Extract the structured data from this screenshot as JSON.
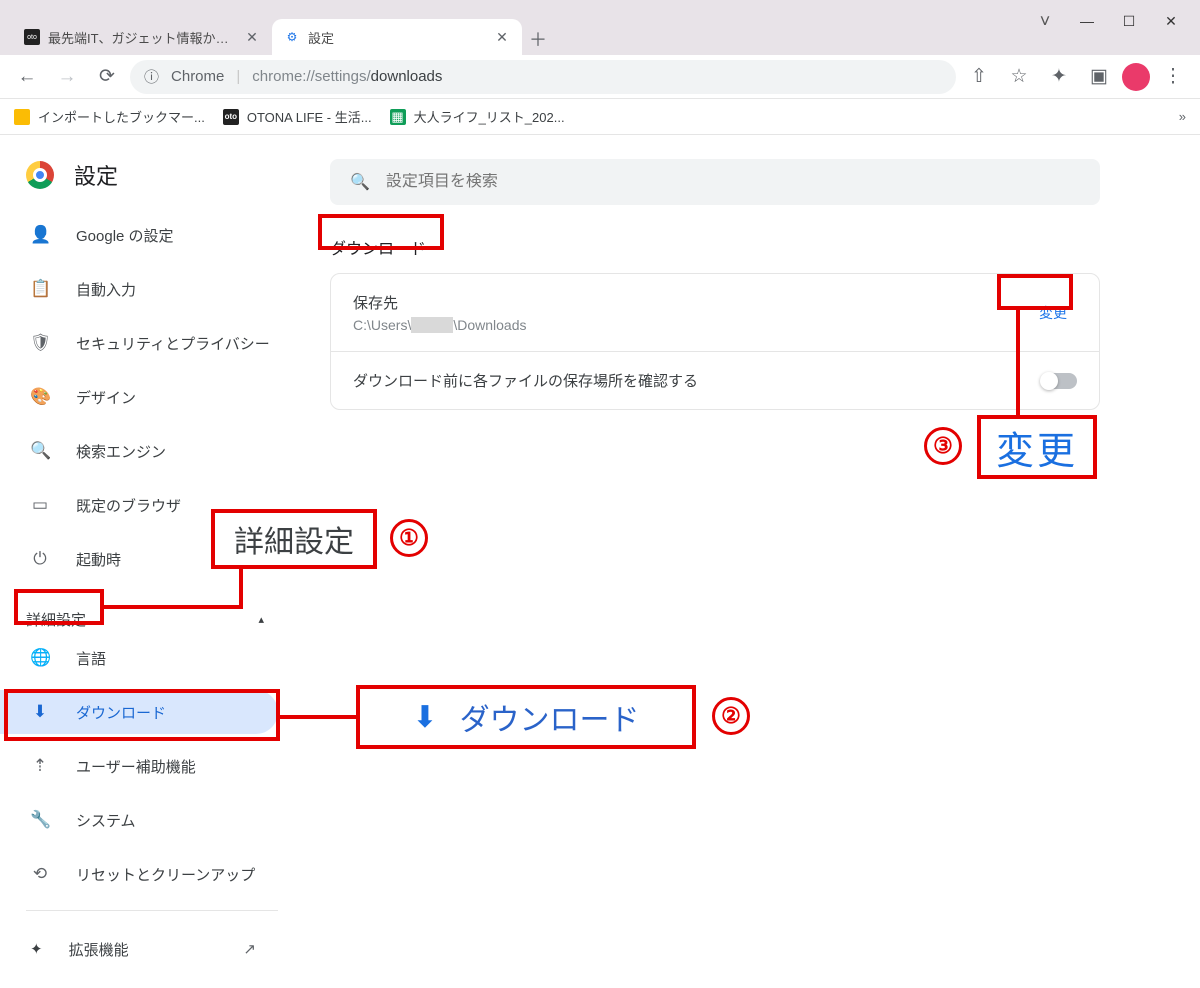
{
  "tabs": [
    {
      "title": "最先端IT、ガジェット情報からアナログ",
      "favicon": "oto"
    },
    {
      "title": "設定",
      "favicon": "gear"
    }
  ],
  "newtab": "＋",
  "winctl": {
    "chev": "˅",
    "min": "—",
    "max": "☐",
    "close": "✕"
  },
  "toolbar": {
    "back": "←",
    "fwd": "→",
    "reload": "⟳",
    "secure_label": "Chrome",
    "url_prefix": "chrome://settings/",
    "url_page": "downloads",
    "share": "⇧",
    "star": "☆",
    "ext": "✦",
    "panel": "▣",
    "menu": "⋮"
  },
  "bookmarks": [
    {
      "icon": "y",
      "label": "インポートしたブックマー..."
    },
    {
      "icon": "d",
      "label": "OTONA LIFE - 生活..."
    },
    {
      "icon": "g",
      "label": "大人ライフ_リスト_202..."
    }
  ],
  "bookmore": "»",
  "sidebar": {
    "title": "設定",
    "items": [
      {
        "ico": "👤",
        "label": "Google の設定"
      },
      {
        "ico": "📋",
        "label": "自動入力"
      },
      {
        "ico": "🛡",
        "label": "セキュリティとプライバシー"
      },
      {
        "ico": "🎨",
        "label": "デザイン"
      },
      {
        "ico": "🔍",
        "label": "検索エンジン"
      },
      {
        "ico": "▭",
        "label": "既定のブラウザ"
      },
      {
        "ico": "⏻",
        "label": "起動時"
      }
    ],
    "advanced": "詳細設定",
    "adv_items": [
      {
        "ico": "🌐",
        "label": "言語"
      },
      {
        "ico": "⬇",
        "label": "ダウンロード",
        "sel": true
      },
      {
        "ico": "⇡",
        "label": "ユーザー補助機能"
      },
      {
        "ico": "🔧",
        "label": "システム"
      },
      {
        "ico": "⟲",
        "label": "リセットとクリーンアップ"
      }
    ],
    "ext": {
      "ico": "✦",
      "label": "拡張機能",
      "launch": "↗"
    }
  },
  "main": {
    "search_placeholder": "設定項目を検索",
    "page_title": "ダウンロード",
    "loc_label": "保存先",
    "loc_path_pre": "C:\\Users\\",
    "loc_path_post": "\\Downloads",
    "change": "変更",
    "ask_label": "ダウンロード前に各ファイルの保存場所を確認する"
  },
  "annot": {
    "n1": "①",
    "n2": "②",
    "n3": "③",
    "adv": "詳細設定",
    "dl": "ダウンロード",
    "chg": "変更"
  }
}
